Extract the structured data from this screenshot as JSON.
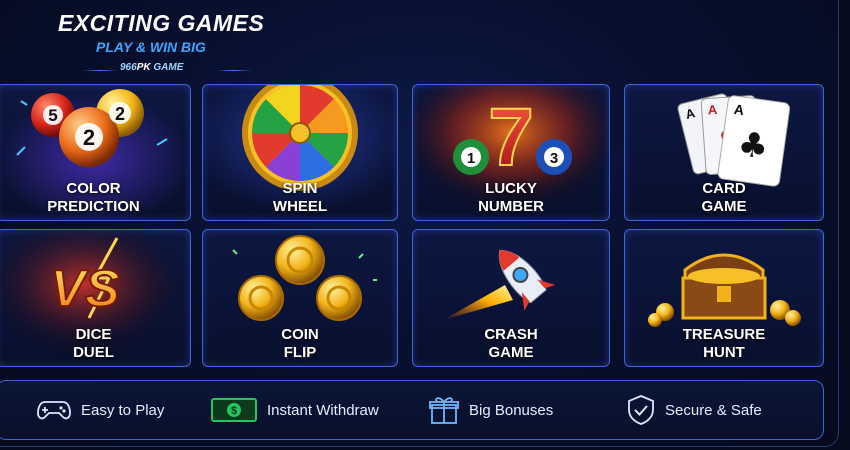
{
  "header": {
    "title": "EXCITING GAMES",
    "subtitle": "PLAY & WIN BIG",
    "brand_number": "966",
    "brand_pk": "PK",
    "brand_suffix": " GAME"
  },
  "games": [
    {
      "line1": "COLOR",
      "line2": "PREDICTION",
      "icon": "lottery-balls-icon",
      "ball_numbers": [
        "5",
        "2",
        "2"
      ]
    },
    {
      "line1": "SPIN",
      "line2": "WHEEL",
      "icon": "prize-wheel-icon"
    },
    {
      "line1": "LUCKY",
      "line2": "NUMBER",
      "icon": "lucky-seven-icon",
      "number": "7",
      "ball_numbers": [
        "1",
        "3"
      ]
    },
    {
      "line1": "CARD",
      "line2": "GAME",
      "icon": "playing-cards-icon",
      "card_rank": "A"
    },
    {
      "line1": "DICE",
      "line2": "DUEL",
      "icon": "versus-icon",
      "versus_text": "VS"
    },
    {
      "line1": "COIN",
      "line2": "FLIP",
      "icon": "gold-coins-icon"
    },
    {
      "line1": "CRASH",
      "line2": "GAME",
      "icon": "rocket-icon"
    },
    {
      "line1": "TREASURE",
      "line2": "HUNT",
      "icon": "treasure-chest-icon"
    }
  ],
  "features": [
    {
      "label": "Easy to Play",
      "icon": "gamepad-icon"
    },
    {
      "label": "Instant Withdraw",
      "icon": "cash-icon"
    },
    {
      "label": "Big Bonuses",
      "icon": "gift-icon"
    },
    {
      "label": "Secure & Safe",
      "icon": "shield-check-icon"
    }
  ],
  "colors": {
    "accent_blue": "#3fa6ff",
    "card_border": "#3f63d9",
    "gold": "#f6c026",
    "cash_green": "#22c55e"
  }
}
